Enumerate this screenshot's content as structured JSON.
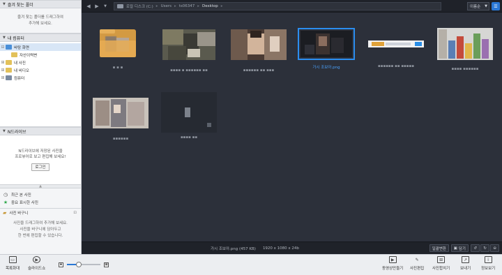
{
  "left": {
    "favorites": {
      "title": "즐겨 찾는 폴더",
      "hint_line1": "즐겨 찾는 폴더를 드래그하여",
      "hint_line2": "추가해 보세요."
    },
    "my_computer": {
      "title": "내 컴퓨터",
      "items": [
        {
          "label": "바탕 화면",
          "color": "#4a8fd8",
          "selected": true
        },
        {
          "label": "자산이력변",
          "color": "#e2c15a"
        },
        {
          "label": "내 사진",
          "color": "#e2c15a"
        },
        {
          "label": "내 비디오",
          "color": "#e2c15a"
        },
        {
          "label": "컴퓨터",
          "color": "#7a8aa0"
        }
      ]
    },
    "ndrive": {
      "title": "N드라이브",
      "line1": "N드라이브에 저장된 사진을",
      "line2": "프로뷰어로 보고 편집해 보세요!",
      "login": "로그인"
    },
    "recent": {
      "recent_label": "최근 본 사진",
      "important_label": "중요 표시한 사진"
    },
    "basket": {
      "title": "사진 바구니",
      "line1": "사진을 드래그하여 추가해 보세요.",
      "line2": "사진을 바구니에 담아두고",
      "line3": "한 번에 편집할 수 있습니다."
    }
  },
  "topbar": {
    "path": [
      "로컬 디스크 (C:)",
      "Users",
      "ts06347",
      "Desktop"
    ],
    "sort_label": "이름순"
  },
  "grid": {
    "items": [
      {
        "caption": "▪ ▪ ▪",
        "kind": "folder"
      },
      {
        "caption": "▪▪▪▪ ▪ ▪▪▪▪▪▪ ▪▪",
        "kind": "photo1"
      },
      {
        "caption": "▪▪▪▪▪▪ ▪▪ ▪▪▪",
        "kind": "photo2"
      },
      {
        "caption": "가시 조보아.png",
        "kind": "photo3",
        "selected": true
      },
      {
        "caption": "▪▪▪▪▪▪ ▪▪ ▪▪▪▪▪",
        "kind": "bar"
      },
      {
        "caption": "▪▪▪▪ ▪▪▪▪▪▪",
        "kind": "colors"
      },
      {
        "caption": "▪▪▪▪▪▪",
        "kind": "photo4"
      },
      {
        "caption": "▪▪▪▪ ▪▪",
        "kind": "blank"
      }
    ]
  },
  "status": {
    "file": "가시 조보아.png (457 KB)",
    "resolution": "1920 x 1080 x 24b",
    "batch_label": "일괄변환",
    "save_label": "담기"
  },
  "bottom": {
    "fit_label": "목록화대",
    "slideshow_label": "슬라이드쇼",
    "zoom_level": 0.35,
    "movie_label": "동영상만들기",
    "edit_label": "사진편집",
    "merge_label": "사진합치기",
    "send_label": "보내기",
    "info_label": "정보보기"
  }
}
